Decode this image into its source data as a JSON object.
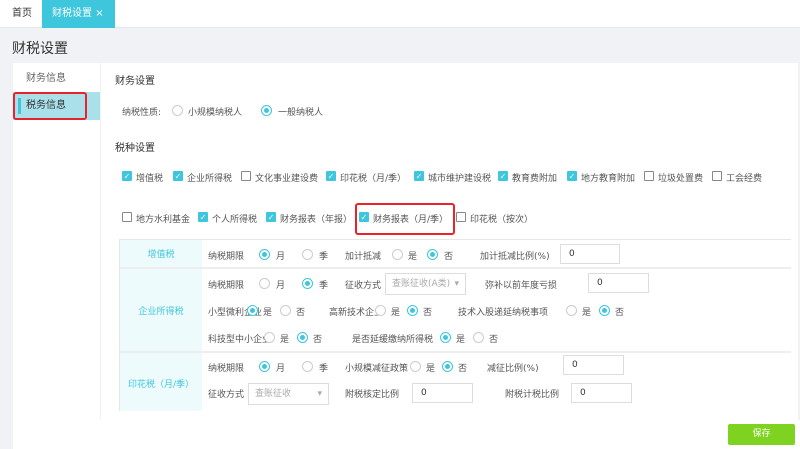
{
  "tabs": [
    {
      "label": "首页"
    },
    {
      "label": "财税设置",
      "close": "×"
    }
  ],
  "page_title": "财税设置",
  "sidebar": {
    "items": [
      {
        "label": "财务信息"
      },
      {
        "label": "税务信息"
      }
    ]
  },
  "finance": {
    "title": "财务设置",
    "taxpayer_label": "纳税性质:",
    "options": [
      "小规模纳税人",
      "一般纳税人"
    ],
    "selected": "一般纳税人"
  },
  "taxes": {
    "title": "税种设置",
    "items": [
      {
        "label": "增值税",
        "checked": true
      },
      {
        "label": "企业所得税",
        "checked": true
      },
      {
        "label": "文化事业建设费",
        "checked": false
      },
      {
        "label": "印花税（月/季）",
        "checked": true
      },
      {
        "label": "城市维护建设税",
        "checked": true
      },
      {
        "label": "教育费附加",
        "checked": true
      },
      {
        "label": "地方教育附加",
        "checked": true
      },
      {
        "label": "垃圾处置费",
        "checked": false
      },
      {
        "label": "工会经费",
        "checked": false
      },
      {
        "label": "地方水利基金",
        "checked": false
      },
      {
        "label": "个人所得税",
        "checked": true
      },
      {
        "label": "财务报表（年报）",
        "checked": true
      },
      {
        "label": "财务报表（月/季）",
        "checked": true
      },
      {
        "label": "印花税（按次）",
        "checked": false
      }
    ]
  },
  "table": {
    "vat": {
      "name": "增值税",
      "period": "纳税期限",
      "month": "月",
      "quarter": "季",
      "deduct": "加计抵减",
      "yes": "是",
      "no": "否",
      "ratio": "加计抵减比例(%)",
      "ratio_value": "0"
    },
    "cit": {
      "name": "企业所得税",
      "period": "纳税期限",
      "month": "月",
      "quarter": "季",
      "method": "征收方式",
      "method_value": "查账征收(A类)",
      "loss": "弥补以前年度亏损",
      "loss_value": "0",
      "small": "小型微利企业",
      "hitech": "高新技术企业",
      "tech_equity": "技术入股递延纳税事项",
      "sme": "科技型中小企业",
      "defer": "是否延缓缴纳所得税",
      "yes": "是",
      "no": "否"
    },
    "stamp": {
      "name": "印花税（月/季）",
      "period": "纳税期限",
      "month": "月",
      "quarter": "季",
      "policy": "小规模减征政策",
      "yes": "是",
      "no": "否",
      "reduce": "减征比例(%)",
      "reduce_value": "0",
      "method": "征收方式",
      "method_value": "查账征收",
      "r1": "附税核定比例",
      "r1_value": "0",
      "r2": "附税计税比例",
      "r2_value": "0"
    }
  },
  "save_label": "保存"
}
